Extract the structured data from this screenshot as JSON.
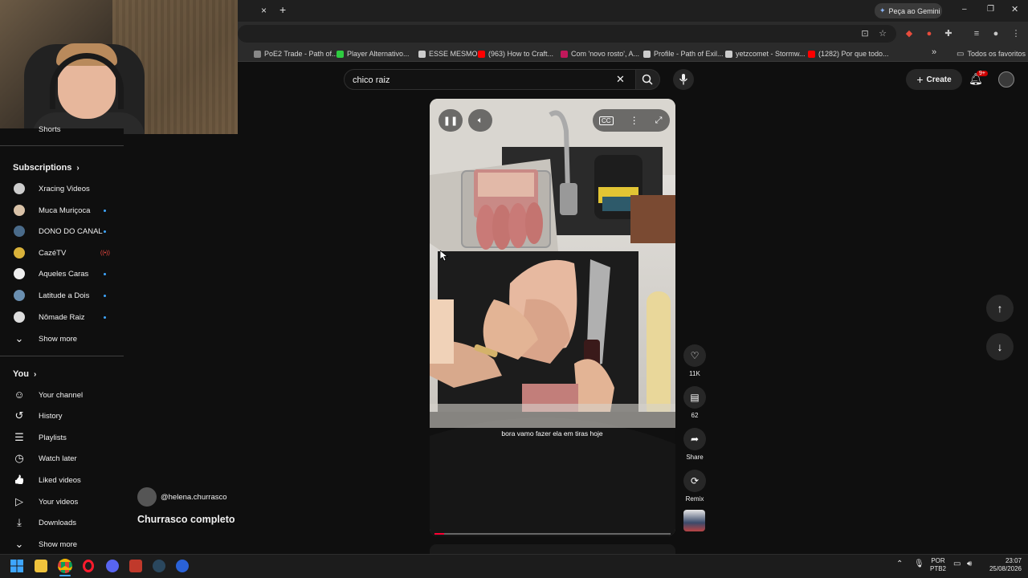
{
  "browser": {
    "gemini_label": "Peça ao Gemini",
    "new_tab_symbol": "+",
    "close_tab_symbol": "×",
    "bookmarks": [
      {
        "label": "PoE2 Trade - Path of...",
        "color": "#888888"
      },
      {
        "label": "Player Alternativo...",
        "color": "#2ecc40"
      },
      {
        "label": "ESSE MESMO",
        "color": "#cccccc"
      },
      {
        "label": "(963) How to Craft...",
        "color": "#ff0000"
      },
      {
        "label": "Com 'novo rosto', A...",
        "color": "#c2185b"
      },
      {
        "label": "Profile - Path of Exil...",
        "color": "#cccccc"
      },
      {
        "label": "yetzcomet - Stormw...",
        "color": "#cccccc"
      },
      {
        "label": "(1282) Por que todo...",
        "color": "#ff0000"
      }
    ],
    "bookmarks_overflow": "»",
    "all_bookmarks": "Todos os favoritos"
  },
  "search": {
    "query": "chico raiz"
  },
  "header": {
    "create_label": "Create",
    "notification_count": "9+"
  },
  "sidebar": {
    "shorts_label": "Shorts",
    "subscriptions_label": "Subscriptions",
    "subscriptions": [
      {
        "name": "Xracing Videos",
        "color": "#cccccc",
        "indicator": "none"
      },
      {
        "name": "Muca Muriçoca",
        "color": "#d9c2a8",
        "indicator": "dot"
      },
      {
        "name": "DONO DO CANAL",
        "color": "#4a6b8a",
        "indicator": "dot"
      },
      {
        "name": "CazéTV",
        "color": "#d9b23a",
        "indicator": "live"
      },
      {
        "name": "Aqueles Caras",
        "color": "#eeeeee",
        "indicator": "dot"
      },
      {
        "name": "Latitude a Dois",
        "color": "#6a8fb0",
        "indicator": "dot"
      },
      {
        "name": "Nômade Raiz",
        "color": "#dddddd",
        "indicator": "dot"
      }
    ],
    "show_more_1": "Show more",
    "you_label": "You",
    "you_items": [
      {
        "label": "Your channel",
        "icon": "person-icon",
        "glyph": "☺"
      },
      {
        "label": "History",
        "icon": "history-icon",
        "glyph": "↺"
      },
      {
        "label": "Playlists",
        "icon": "playlists-icon",
        "glyph": "☰"
      },
      {
        "label": "Watch later",
        "icon": "clock-icon",
        "glyph": "◷"
      },
      {
        "label": "Liked videos",
        "icon": "thumb-up-icon",
        "glyph": "👍"
      },
      {
        "label": "Your videos",
        "icon": "video-icon",
        "glyph": "▷"
      },
      {
        "label": "Downloads",
        "icon": "download-icon",
        "glyph": "⤓"
      }
    ],
    "show_more_2": "Show more"
  },
  "short": {
    "caption": "bora vamo fazer ela em tiras hoje",
    "progress": 0.04,
    "channel_handle": "@helena.churrasco",
    "title": "Churrasco completo",
    "likes": "11K",
    "comments": "62",
    "share_label": "Share",
    "remix_label": "Remix"
  },
  "taskbar": {
    "lang_line1": "POR",
    "lang_line2": "PTB2",
    "time": "23:07",
    "date": "25/08/2026"
  }
}
